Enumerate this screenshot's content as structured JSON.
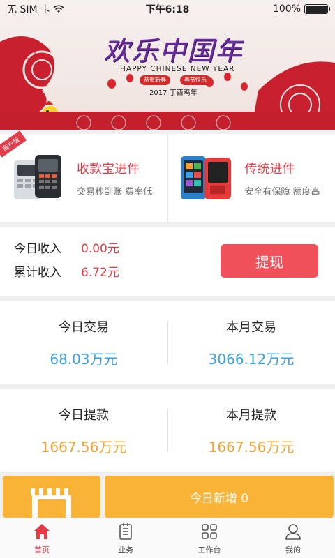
{
  "status_bar": {
    "carrier": "无 SIM 卡",
    "time": "下午6:18",
    "battery": "100%"
  },
  "banner": {
    "title": "欢乐中国年",
    "subtitle": "HAPPY CHINESE NEW YEAR",
    "tag_left": "恭贺新春",
    "tag_right": "春节快乐",
    "year_line": "2017 丁酉鸡年"
  },
  "cards": [
    {
      "ribbon": "商户版",
      "title": "收款宝进件",
      "subtitle": "交易秒到账 费率低"
    },
    {
      "title": "传统进件",
      "subtitle": "安全有保障 额度高"
    }
  ],
  "income": {
    "today_label": "今日收入",
    "today_value": "0.00元",
    "total_label": "累计收入",
    "total_value": "6.72元",
    "withdraw_button": "提现"
  },
  "transactions": {
    "today_label": "今日交易",
    "today_value": "68.03万元",
    "month_label": "本月交易",
    "month_value": "3066.12万元"
  },
  "withdrawals": {
    "today_label": "今日提款",
    "today_value": "1667.56万元",
    "month_label": "本月提款",
    "month_value": "1667.56万元"
  },
  "new_today": {
    "label": "今日新增 0"
  },
  "tabs": [
    {
      "label": "首页",
      "icon": "home-icon",
      "active": true
    },
    {
      "label": "业务",
      "icon": "document-icon",
      "active": false
    },
    {
      "label": "工作台",
      "icon": "grid-icon",
      "active": false
    },
    {
      "label": "我的",
      "icon": "user-icon",
      "active": false
    }
  ],
  "colors": {
    "accent_red": "#e23b46",
    "blue": "#3a9fe0",
    "orange": "#f2a232",
    "banner_yellow": "#f9b337"
  }
}
